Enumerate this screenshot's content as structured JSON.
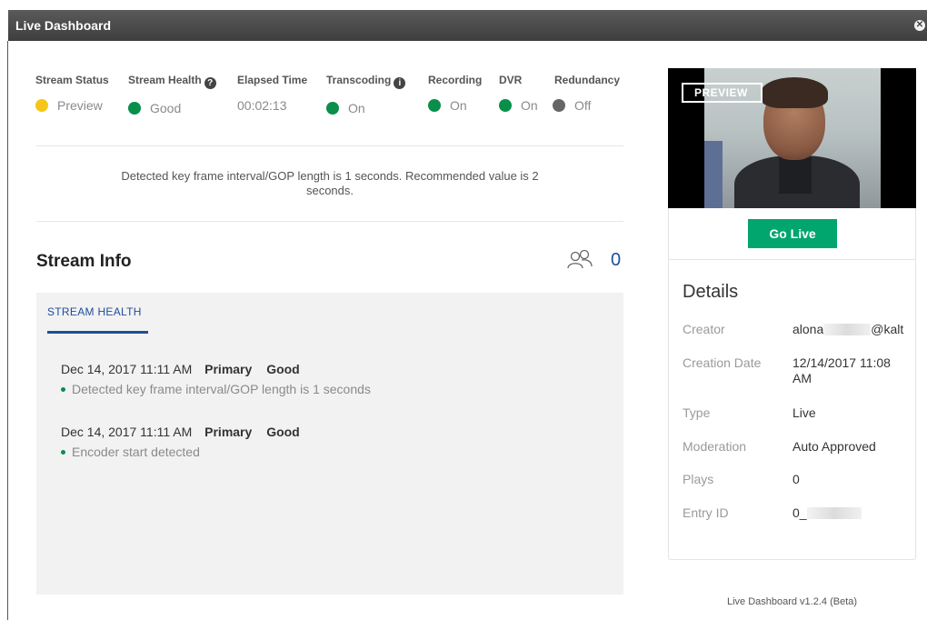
{
  "window": {
    "title": "Live Dashboard"
  },
  "status": {
    "stream_status": {
      "label": "Stream Status",
      "value": "Preview",
      "color": "#f5c518"
    },
    "stream_health": {
      "label": "Stream Health",
      "value": "Good",
      "color": "#0a8f4a"
    },
    "elapsed_time": {
      "label": "Elapsed Time",
      "value": "00:02:13"
    },
    "transcoding": {
      "label": "Transcoding",
      "value": "On",
      "color": "#0a8f4a"
    },
    "recording": {
      "label": "Recording",
      "value": "On",
      "color": "#0a8f4a"
    },
    "dvr": {
      "label": "DVR",
      "value": "On",
      "color": "#0a8f4a"
    },
    "redundancy": {
      "label": "Redundancy",
      "value": "Off",
      "color": "#666666"
    }
  },
  "gop_message": {
    "line1": "Detected key frame interval/GOP length is 1 seconds. Recommended value is 2",
    "line2": "seconds."
  },
  "stream_info": {
    "title": "Stream Info",
    "viewers": "0"
  },
  "health_panel": {
    "tab": "STREAM HEALTH",
    "entries": [
      {
        "date": "Dec 14, 2017 11:11 AM",
        "source": "Primary",
        "status": "Good",
        "message": "Detected key frame interval/GOP length is 1 seconds"
      },
      {
        "date": "Dec 14, 2017 11:11 AM",
        "source": "Primary",
        "status": "Good",
        "message": "Encoder start detected"
      }
    ]
  },
  "preview": {
    "badge": "PREVIEW",
    "go_live": "Go Live"
  },
  "details": {
    "title": "Details",
    "creator": {
      "label": "Creator",
      "prefix": "alona",
      "suffix": "@kalt"
    },
    "creation_date": {
      "label": "Creation Date",
      "value": "12/14/2017 11:08 AM"
    },
    "type": {
      "label": "Type",
      "value": "Live"
    },
    "moderation": {
      "label": "Moderation",
      "value": "Auto Approved"
    },
    "plays": {
      "label": "Plays",
      "value": "0"
    },
    "entry_id": {
      "label": "Entry ID",
      "prefix": "0_"
    }
  },
  "footer": "Live Dashboard v1.2.4 (Beta)",
  "colors": {
    "accent_blue": "#1f4d9a",
    "go_live_green": "#00a66e"
  }
}
